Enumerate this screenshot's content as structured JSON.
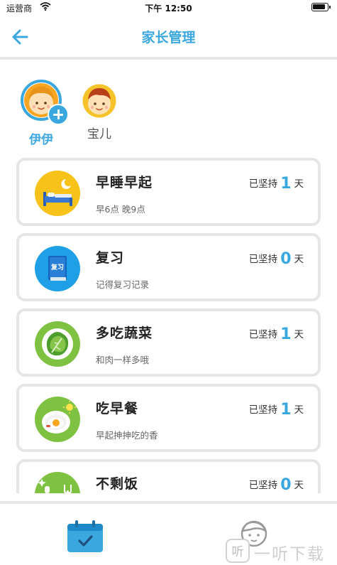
{
  "status_bar": {
    "carrier": "运营商",
    "time": "下午 12:50"
  },
  "nav": {
    "title": "家长管理",
    "back_icon": "back-arrow-icon"
  },
  "children": [
    {
      "name": "伊伊",
      "selected": true,
      "has_add_badge": true
    },
    {
      "name": "宝儿",
      "selected": false
    }
  ],
  "habits": [
    {
      "name": "早睡早起",
      "desc": "早6点 晚9点",
      "streak_prefix": "已坚持",
      "streak_value": "1",
      "streak_suffix": "天",
      "icon": "bed-moon-icon"
    },
    {
      "name": "复习",
      "desc": "记得复习记录",
      "streak_prefix": "已坚持",
      "streak_value": "0",
      "streak_suffix": "天",
      "icon": "review-book-icon",
      "icon_text": "复习"
    },
    {
      "name": "多吃蔬菜",
      "desc": "和肉一样多哦",
      "streak_prefix": "已坚持",
      "streak_value": "1",
      "streak_suffix": "天",
      "icon": "lettuce-icon"
    },
    {
      "name": "吃早餐",
      "desc": "早起抻抻吃的香",
      "streak_prefix": "已坚持",
      "streak_value": "1",
      "streak_suffix": "天",
      "icon": "breakfast-plate-icon"
    },
    {
      "name": "不剩饭",
      "desc": "",
      "streak_prefix": "已坚持",
      "streak_value": "0",
      "streak_suffix": "天",
      "icon": "plate-utensils-icon"
    }
  ],
  "tabbar": {
    "tabs": [
      {
        "icon": "calendar-check-icon",
        "active": true
      },
      {
        "icon": "child-profile-icon",
        "active": false
      }
    ]
  },
  "watermark": {
    "logo_text": "听",
    "text": "一听下载"
  },
  "colors": {
    "accent": "#3aa7df",
    "card_border": "#e6e6e6",
    "divider": "#e7e7e7"
  }
}
